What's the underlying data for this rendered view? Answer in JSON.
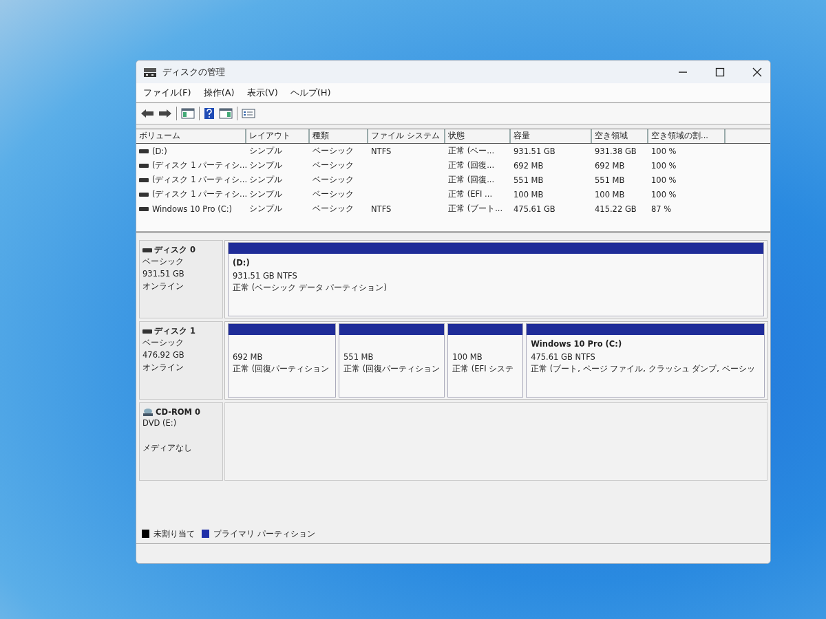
{
  "window": {
    "title": "ディスクの管理"
  },
  "menu": [
    "ファイル(F)",
    "操作(A)",
    "表示(V)",
    "ヘルプ(H)"
  ],
  "volume_table": {
    "columns": [
      "ボリューム",
      "レイアウト",
      "種類",
      "ファイル システム",
      "状態",
      "容量",
      "空き領域",
      "空き領域の割..."
    ],
    "rows": [
      [
        "(D:)",
        "シンプル",
        "ベーシック",
        "NTFS",
        "正常 (ベー...",
        "931.51 GB",
        "931.38 GB",
        "100 %"
      ],
      [
        "(ディスク 1 パーティシ...",
        "シンプル",
        "ベーシック",
        "",
        "正常 (回復...",
        "692 MB",
        "692 MB",
        "100 %"
      ],
      [
        "(ディスク 1 パーティシ...",
        "シンプル",
        "ベーシック",
        "",
        "正常 (回復...",
        "551 MB",
        "551 MB",
        "100 %"
      ],
      [
        "(ディスク 1 パーティシ...",
        "シンプル",
        "ベーシック",
        "",
        "正常 (EFI ...",
        "100 MB",
        "100 MB",
        "100 %"
      ],
      [
        "Windows 10 Pro (C:)",
        "シンプル",
        "ベーシック",
        "NTFS",
        "正常 (ブート...",
        "475.61 GB",
        "415.22 GB",
        "87 %"
      ]
    ]
  },
  "disks": [
    {
      "kind": "disk",
      "name": "ディスク 0",
      "lines": [
        "ベーシック",
        "931.51 GB",
        "オンライン"
      ],
      "partitions": [
        {
          "title": "(D:)",
          "lines": [
            "931.51 GB NTFS",
            "正常 (ベーシック データ パーティション)"
          ]
        }
      ]
    },
    {
      "kind": "disk",
      "name": "ディスク 1",
      "lines": [
        "ベーシック",
        "476.92 GB",
        "オンライン"
      ],
      "partitions": [
        {
          "lines": [
            "692 MB",
            "正常 (回復パーティション"
          ]
        },
        {
          "lines": [
            "551 MB",
            "正常 (回復パーティション"
          ]
        },
        {
          "lines": [
            "100 MB",
            "正常 (EFI システ"
          ]
        },
        {
          "title": "Windows 10 Pro  (C:)",
          "lines": [
            "475.61 GB NTFS",
            "正常 (ブート, ページ ファイル, クラッシュ ダンプ, ベーシッ"
          ]
        }
      ]
    },
    {
      "kind": "cdrom",
      "name": "CD-ROM 0",
      "lines": [
        "DVD (E:)",
        "メディアなし"
      ]
    }
  ],
  "legend": [
    {
      "label": "未割り当て",
      "color": "#000000"
    },
    {
      "label": "プライマリ パーティション",
      "color": "#1f2fa8"
    }
  ]
}
